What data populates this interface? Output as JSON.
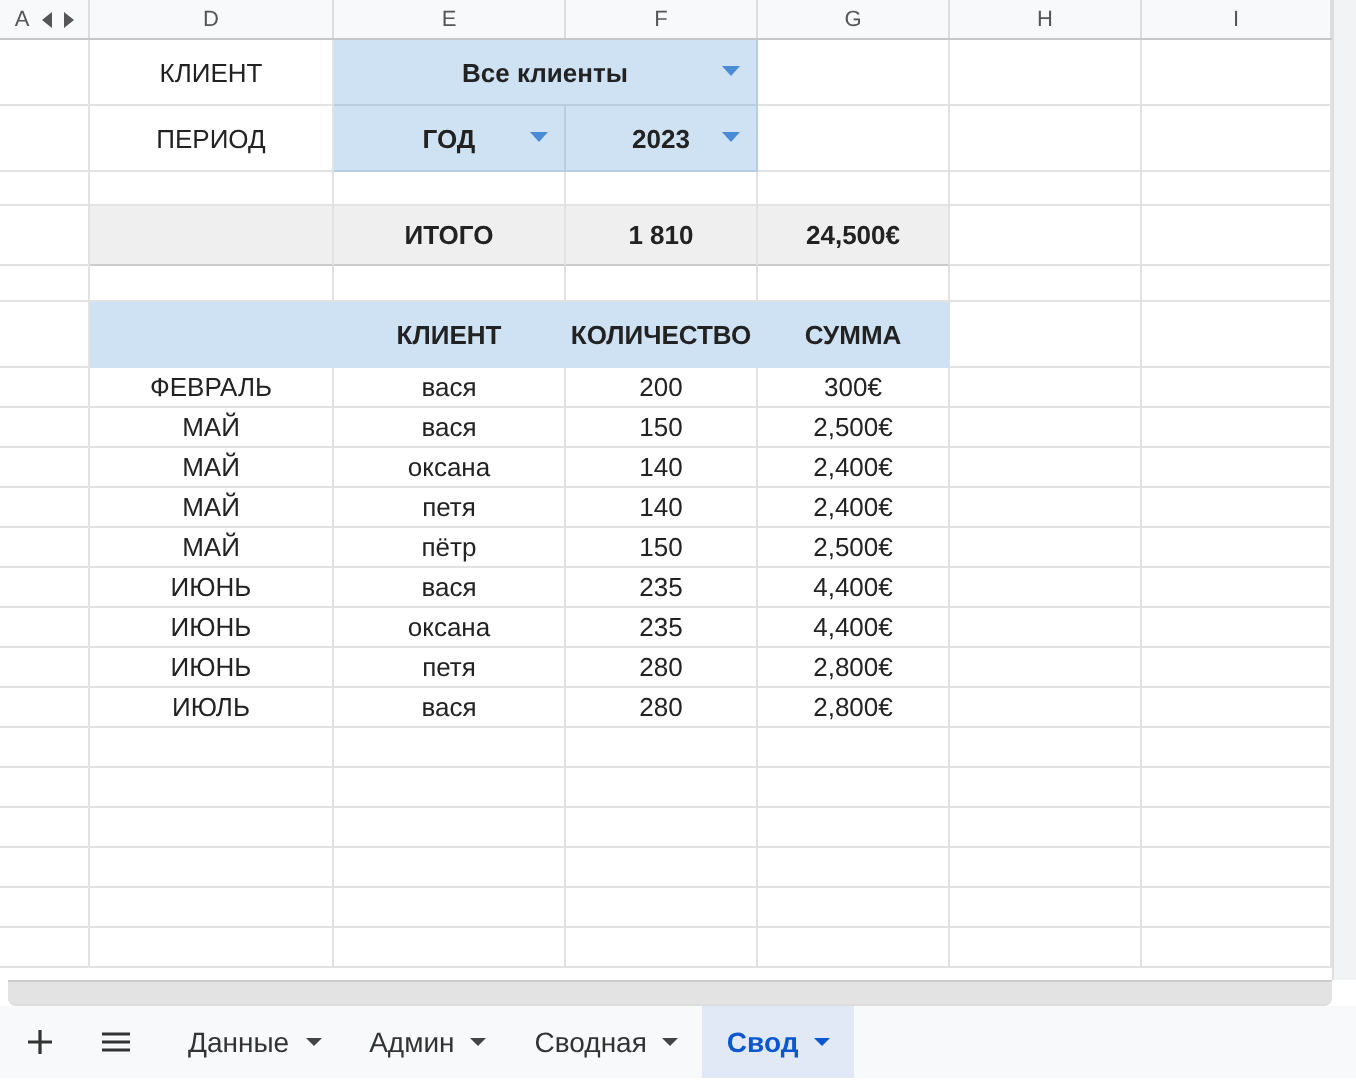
{
  "column_headers": [
    "A",
    "D",
    "E",
    "F",
    "G",
    "H",
    "I"
  ],
  "filters": [
    {
      "label": "КЛИЕНТ",
      "dropdowns": [
        "Все клиенты"
      ]
    },
    {
      "label": "ПЕРИОД",
      "dropdowns": [
        "ГОД",
        "2023"
      ]
    }
  ],
  "total": {
    "label": "ИТОГО",
    "quantity": "1 810",
    "sum": "24,500€"
  },
  "table": {
    "columns": [
      "",
      "КЛИЕНТ",
      "КОЛИЧЕСТВО",
      "СУММА"
    ],
    "rows": [
      [
        "ФЕВРАЛЬ",
        "вася",
        "200",
        "300€"
      ],
      [
        "МАЙ",
        "вася",
        "150",
        "2,500€"
      ],
      [
        "МАЙ",
        "оксана",
        "140",
        "2,400€"
      ],
      [
        "МАЙ",
        "петя",
        "140",
        "2,400€"
      ],
      [
        "МАЙ",
        "пётр",
        "150",
        "2,500€"
      ],
      [
        "ИЮНЬ",
        "вася",
        "235",
        "4,400€"
      ],
      [
        "ИЮНЬ",
        "оксана",
        "235",
        "4,400€"
      ],
      [
        "ИЮНЬ",
        "петя",
        "280",
        "2,800€"
      ],
      [
        "ИЮЛЬ",
        "вася",
        "280",
        "2,800€"
      ]
    ]
  },
  "sheet_tabs": [
    {
      "label": "Данные",
      "selected": false
    },
    {
      "label": "Админ",
      "selected": false
    },
    {
      "label": "Сводная",
      "selected": false
    },
    {
      "label": "Свод",
      "selected": true
    }
  ]
}
